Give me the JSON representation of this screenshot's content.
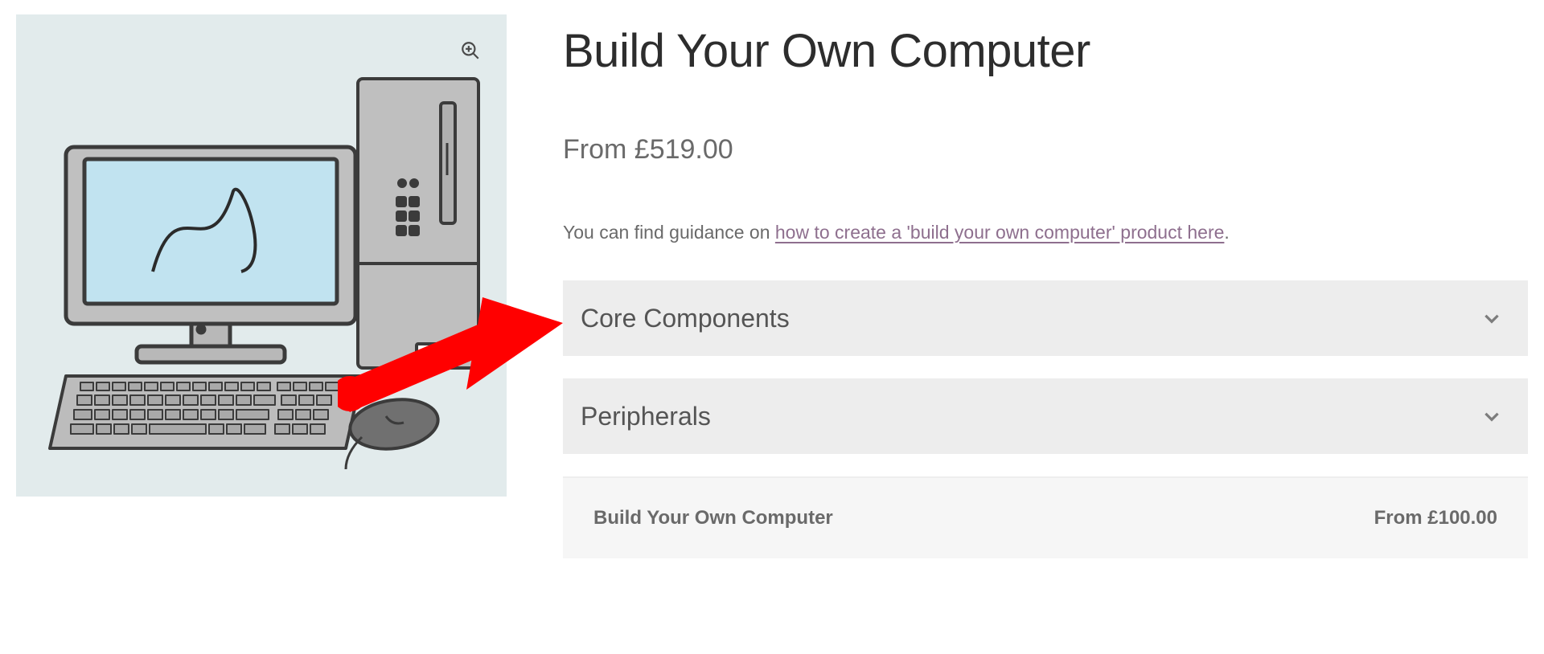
{
  "product": {
    "title": "Build Your Own Computer",
    "price_prefix": "From ",
    "price": "£519.00",
    "guidance_prefix": "You can find guidance on ",
    "guidance_link_text": "how to create a 'build your own computer' product here",
    "guidance_suffix": "."
  },
  "accordions": [
    {
      "label": "Core Components"
    },
    {
      "label": "Peripherals"
    }
  ],
  "footer": {
    "name": "Build Your Own Computer",
    "price": "From £100.00"
  }
}
